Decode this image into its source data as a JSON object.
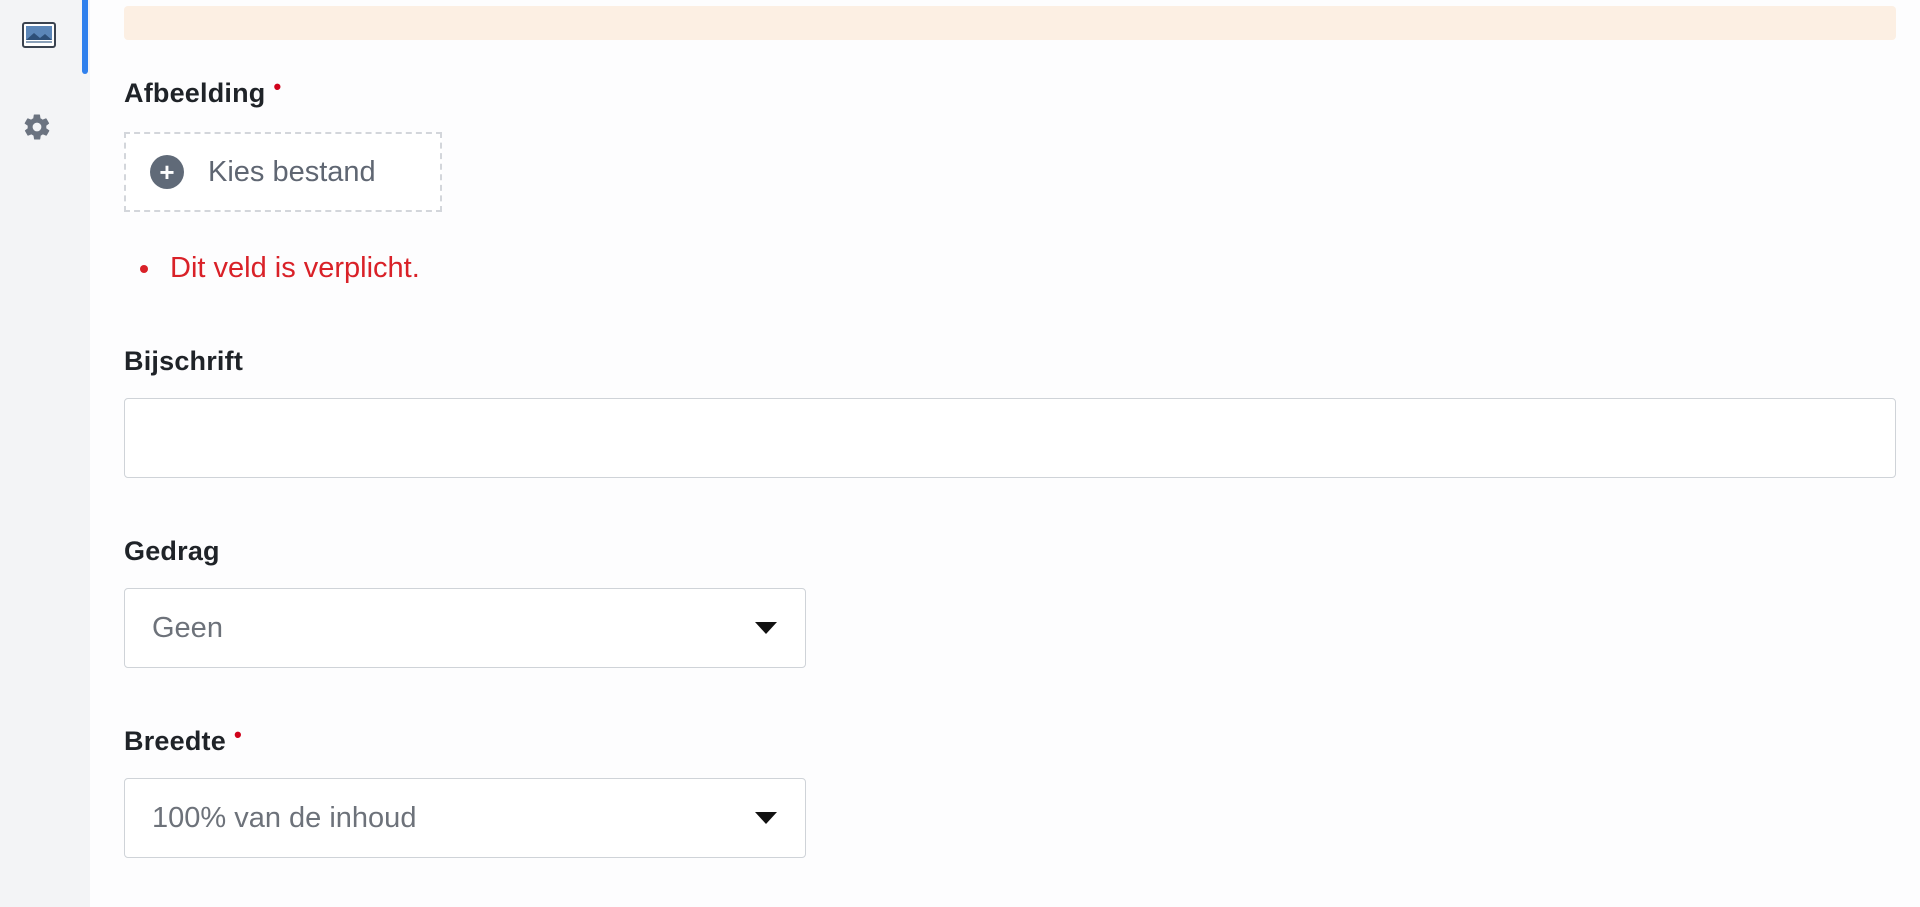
{
  "sidebar": {
    "tabs": [
      {
        "icon": "image-icon",
        "active": true
      },
      {
        "icon": "gear-icon",
        "active": false
      }
    ],
    "accent_color": "#2f80ed"
  },
  "form": {
    "image_field": {
      "label": "Afbeelding",
      "required_mark": "•",
      "button_label": "Kies bestand",
      "button_icon": "plus-circle-icon",
      "error": "Dit veld is verplicht."
    },
    "caption_field": {
      "label": "Bijschrift",
      "value": "",
      "placeholder": ""
    },
    "behavior_field": {
      "label": "Gedrag",
      "selected": "Geen"
    },
    "width_field": {
      "label": "Breedte",
      "required_mark": "•",
      "selected": "100% van de inhoud"
    }
  },
  "colors": {
    "error": "#d92128",
    "required": "#d0021b",
    "warning_bar": "#fcefe3"
  }
}
